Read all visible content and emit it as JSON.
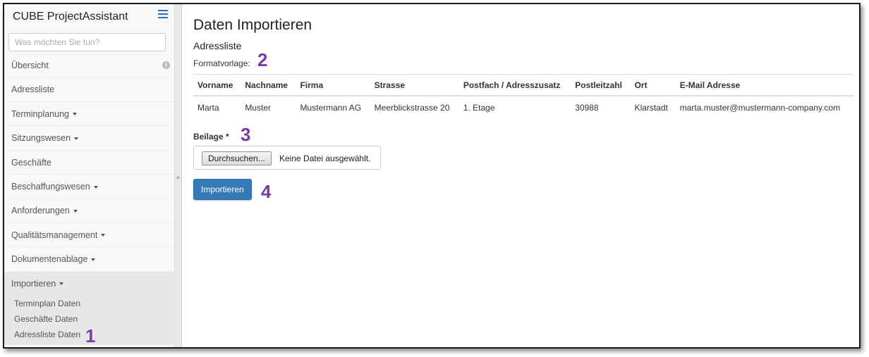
{
  "sidebar": {
    "brand": "CUBE ProjectAssistant",
    "search_placeholder": "Was möchten Sie tun?",
    "items": [
      {
        "label": "Übersicht"
      },
      {
        "label": "Adressliste"
      },
      {
        "label": "Terminplanung"
      },
      {
        "label": "Sitzungswesen"
      },
      {
        "label": "Geschäfte"
      },
      {
        "label": "Beschaffungswesen"
      },
      {
        "label": "Anforderungen"
      },
      {
        "label": "Qualitätsmanagement"
      },
      {
        "label": "Dokumentenablage"
      },
      {
        "label": "Importieren"
      }
    ],
    "submenu": [
      {
        "label": "Terminplan Daten"
      },
      {
        "label": "Geschäfte Daten"
      },
      {
        "label": "Adressliste Daten"
      }
    ]
  },
  "main": {
    "title": "Daten Importieren",
    "subtitle": "Adressliste",
    "template_label": "Formatvorlage:",
    "table": {
      "headers": [
        "Vorname",
        "Nachname",
        "Firma",
        "Strasse",
        "Postfach / Adresszusatz",
        "Postleitzahl",
        "Ort",
        "E-Mail Adresse"
      ],
      "rows": [
        [
          "Marta",
          "Muster",
          "Mustermann AG",
          "Meerblickstrasse 20",
          "1. Etage",
          "30988",
          "Klarstadt",
          "marta.muster@mustermann-company.com"
        ]
      ]
    },
    "attachment_label": "Beilage *",
    "browse_label": "Durchsuchen...",
    "file_status": "Keine Datei ausgewählt.",
    "import_label": "Importieren"
  },
  "callouts": {
    "c1": "1",
    "c2": "2",
    "c3": "3",
    "c4": "4"
  },
  "colors": {
    "accent": "#337ab7",
    "callout": "#7c3aa7",
    "sidebar_bg": "#f8f8f8"
  },
  "icons": {
    "menu": "hamburger-icon",
    "info": "info-icon",
    "dropdown": "caret-down-icon",
    "splitter": "grip-icon"
  }
}
